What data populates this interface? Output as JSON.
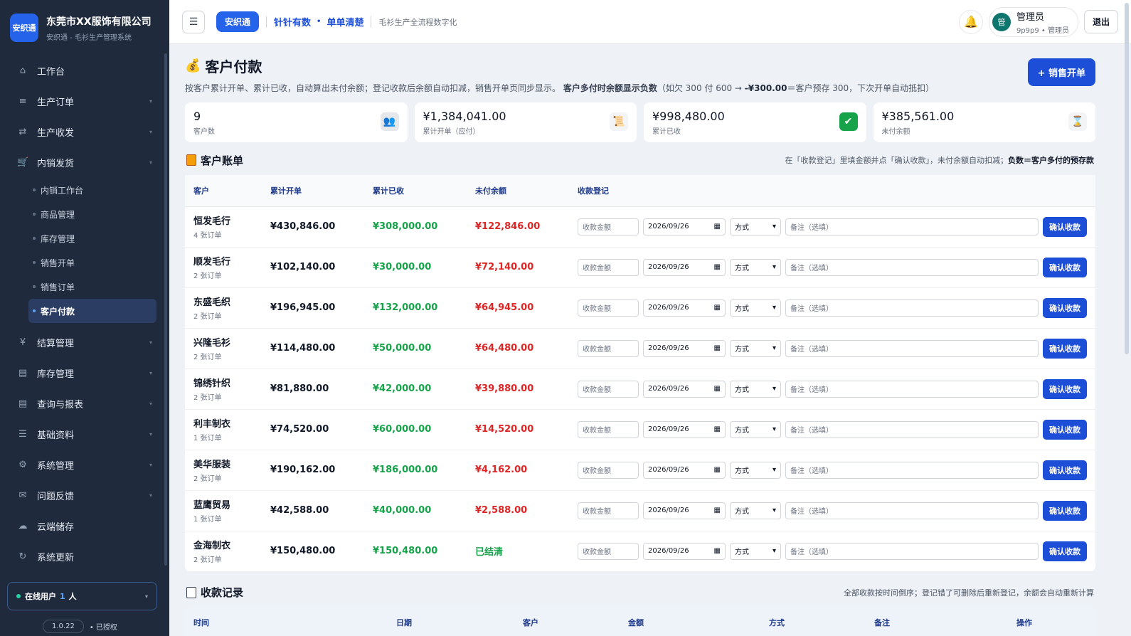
{
  "brand": {
    "logo_text": "安织通",
    "company": "东莞市XX服饰有限公司",
    "subtitle": "安织通 - 毛衫生产管理系统"
  },
  "nav": {
    "items_top": [
      {
        "icon": "home-icon",
        "glyph": "⌂",
        "label": "工作台",
        "caret": false
      },
      {
        "icon": "list-icon",
        "glyph": "≡",
        "label": "生产订单",
        "caret": true
      },
      {
        "icon": "transfer-icon",
        "glyph": "⇄",
        "label": "生产收发",
        "caret": true
      },
      {
        "icon": "cart-icon",
        "glyph": "🛒",
        "label": "内销发货",
        "caret": true
      }
    ],
    "sub_items": [
      {
        "label": "内销工作台",
        "active": false
      },
      {
        "label": "商品管理",
        "active": false
      },
      {
        "label": "库存管理",
        "active": false
      },
      {
        "label": "销售开单",
        "active": false
      },
      {
        "label": "销售订单",
        "active": false
      },
      {
        "label": "客户付款",
        "active": true
      }
    ],
    "items_bottom": [
      {
        "icon": "yen-icon",
        "glyph": "¥",
        "label": "结算管理",
        "caret": true
      },
      {
        "icon": "inventory-icon",
        "glyph": "▤",
        "label": "库存管理",
        "caret": true
      },
      {
        "icon": "report-icon",
        "glyph": "▤",
        "label": "查询与报表",
        "caret": true
      },
      {
        "icon": "menu-icon",
        "glyph": "☰",
        "label": "基础资料",
        "caret": true
      },
      {
        "icon": "gear-icon",
        "glyph": "⚙",
        "label": "系统管理",
        "caret": true
      },
      {
        "icon": "mail-icon",
        "glyph": "✉",
        "label": "问题反馈",
        "caret": true
      },
      {
        "icon": "cloud-icon",
        "glyph": "☁",
        "label": "云端储存",
        "caret": false
      },
      {
        "icon": "refresh-icon",
        "glyph": "↻",
        "label": "系统更新",
        "caret": false
      }
    ]
  },
  "online": {
    "label": "在线用户",
    "count": "1",
    "unit": "人"
  },
  "version": {
    "number": "1.0.22",
    "status": "• 已授权"
  },
  "topbar": {
    "menu_glyph": "☰",
    "badge": "安织通",
    "slogan_1": "针针有数",
    "slogan_dot": "•",
    "slogan_2": "单单清楚",
    "desc": "毛衫生产全流程数字化",
    "user_avatar": "管",
    "user_name": "管理员",
    "user_role": "9p9p9 • 管理员",
    "logout": "退出"
  },
  "page": {
    "title_icon": "💰",
    "title": "客户付款",
    "desc_1": "按客户累计开单、累计已收，自动算出未付余额；登记收款后余额自动扣减，销售开单页同步显示。",
    "desc_bold": "客户多付时余额显示负数",
    "desc_2": "（如欠 300 付 600 → ",
    "desc_neg": "-¥300.00",
    "desc_3": "＝客户预存 300，下次开单自动抵扣）",
    "new_button": "+ 销售开单"
  },
  "stats": [
    {
      "value": "9",
      "label": "客户数",
      "icon": "users-icon",
      "glyph": "👥",
      "bg": "#e5e7eb"
    },
    {
      "value": "¥1,384,041.00",
      "label": "累计开单（应付）",
      "icon": "scroll-icon",
      "glyph": "📜",
      "bg": "#f3f4f6"
    },
    {
      "value": "¥998,480.00",
      "label": "累计已收",
      "icon": "check-icon",
      "glyph": "✔",
      "bg": "#16a34a"
    },
    {
      "value": "¥385,561.00",
      "label": "未付余额",
      "icon": "hourglass-icon",
      "glyph": "⌛",
      "bg": "#f3f4f6"
    }
  ],
  "ledger": {
    "title": "客户账单",
    "tip": "在「收款登记」里填金额并点「确认收款」，未付余额自动扣减；",
    "tip_bold": "负数＝客户多付的预存款",
    "headers": [
      "客户",
      "累计开单",
      "累计已收",
      "未付余额",
      "收款登记"
    ],
    "amount_placeholder": "收款金额",
    "date_value": "2026/09/26",
    "method_value": "方式",
    "note_placeholder": "备注（选填）",
    "confirm_label": "确认收款",
    "rows": [
      {
        "name": "恒发毛行",
        "orders": "4 张订单",
        "billed": "¥430,846.00",
        "paid": "¥308,000.00",
        "due": "¥122,846.00",
        "settled": false
      },
      {
        "name": "顺发毛行",
        "orders": "2 张订单",
        "billed": "¥102,140.00",
        "paid": "¥30,000.00",
        "due": "¥72,140.00",
        "settled": false
      },
      {
        "name": "东盛毛织",
        "orders": "2 张订单",
        "billed": "¥196,945.00",
        "paid": "¥132,000.00",
        "due": "¥64,945.00",
        "settled": false
      },
      {
        "name": "兴隆毛衫",
        "orders": "2 张订单",
        "billed": "¥114,480.00",
        "paid": "¥50,000.00",
        "due": "¥64,480.00",
        "settled": false
      },
      {
        "name": "锦绣针织",
        "orders": "2 张订单",
        "billed": "¥81,880.00",
        "paid": "¥42,000.00",
        "due": "¥39,880.00",
        "settled": false
      },
      {
        "name": "利丰制衣",
        "orders": "1 张订单",
        "billed": "¥74,520.00",
        "paid": "¥60,000.00",
        "due": "¥14,520.00",
        "settled": false
      },
      {
        "name": "美华服装",
        "orders": "2 张订单",
        "billed": "¥190,162.00",
        "paid": "¥186,000.00",
        "due": "¥4,162.00",
        "settled": false
      },
      {
        "name": "蓝鹰贸易",
        "orders": "1 张订单",
        "billed": "¥42,588.00",
        "paid": "¥40,000.00",
        "due": "¥2,588.00",
        "settled": false
      },
      {
        "name": "金海制衣",
        "orders": "2 张订单",
        "billed": "¥150,480.00",
        "paid": "¥150,480.00",
        "due": "已结清",
        "settled": true
      }
    ]
  },
  "records": {
    "title": "收款记录",
    "tip": "全部收款按时间倒序；登记错了可删除后重新登记，余额会自动重新计算",
    "headers": [
      "时间",
      "日期",
      "客户",
      "金额",
      "方式",
      "备注",
      "操作"
    ]
  }
}
